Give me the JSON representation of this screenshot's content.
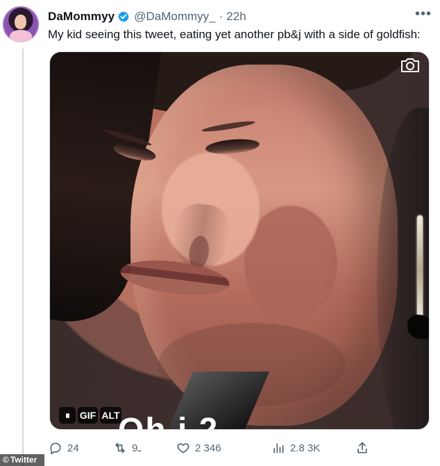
{
  "tweet": {
    "display_name": "DaMommyy",
    "handle": "@DaMommyy_",
    "separator": "·",
    "time": "22h",
    "text": "My kid seeing this tweet, eating yet another pb&j with a side of goldfish:",
    "more_icon": "more-horizontal-icon",
    "verified_icon": "verified-badge-icon"
  },
  "media": {
    "type": "GIF",
    "controls": {
      "pause": "⏸",
      "gif": "GIF",
      "alt": "ALT"
    },
    "caption": "Oh i   2",
    "camera_icon": "camera-icon"
  },
  "actions": {
    "reply_count": "24",
    "retweet_count": "ـ9",
    "like_count": "2 346",
    "views_count": "2.8 3K",
    "icons": [
      "reply-icon",
      "retweet-icon",
      "heart-icon",
      "analytics-icon",
      "share-icon"
    ]
  },
  "watermark": {
    "label": "Twitter",
    "icon": "copyright-icon"
  },
  "colors": {
    "text": "#0f1419",
    "secondary": "#536471",
    "verified": "#1d9bf0",
    "thread_line": "#cfd9de"
  }
}
